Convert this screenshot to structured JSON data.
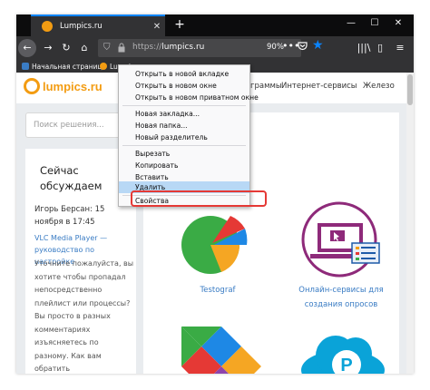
{
  "tab": {
    "title": "Lumpics.ru",
    "close": "✕",
    "new_tab": "+"
  },
  "window_controls": {
    "minimize": "—",
    "maximize": "☐",
    "close": "✕"
  },
  "nav": {
    "back": "←",
    "forward": "→",
    "reload": "↻",
    "home": "⌂",
    "url_prefix": "https://",
    "url_host": "lumpics.ru",
    "zoom": "90%",
    "more": "•••",
    "star": "★",
    "library": "|||\\",
    "sidebar": "▯",
    "menu": "≡"
  },
  "bookmarks": [
    {
      "label": "Начальная страница",
      "color": "#3a7cc4"
    },
    {
      "label": "Lumpics.ru",
      "color": "#f39c12"
    }
  ],
  "site": {
    "logo": "lumpics.ru",
    "nav_links": [
      "граммы",
      "Интернет-сервисы",
      "Железо"
    ],
    "search_placeholder": "Поиск решения...",
    "now_title": "Сейчас обсуждаем",
    "comment_author": "Игорь Берсан: 15 ноября в 17:45",
    "comment_link": "VLC Media Player — руководство по настройке",
    "comment_text": "Уточните пожалуйста, вы хотите чтобы пропадал непосредственно плейлист или процессы? Вы просто в разных комментариях изъясняетесь по разному. Как вам обратить",
    "cards": [
      "Testograf",
      "Онлайн-сервисы для создания опросов"
    ]
  },
  "context_menu": {
    "items": [
      "Открыть в новой вкладке",
      "Открыть в новом окне",
      "Открыть в новом приватном окне",
      "Новая закладка...",
      "Новая папка...",
      "Новый разделитель",
      "Вырезать",
      "Копировать",
      "Вставить",
      "Удалить",
      "Свойства"
    ]
  },
  "colors": {
    "accent": "#0a84ff",
    "brand": "#f39c12",
    "highlight": "#e53935",
    "link": "#3a7cc4"
  }
}
